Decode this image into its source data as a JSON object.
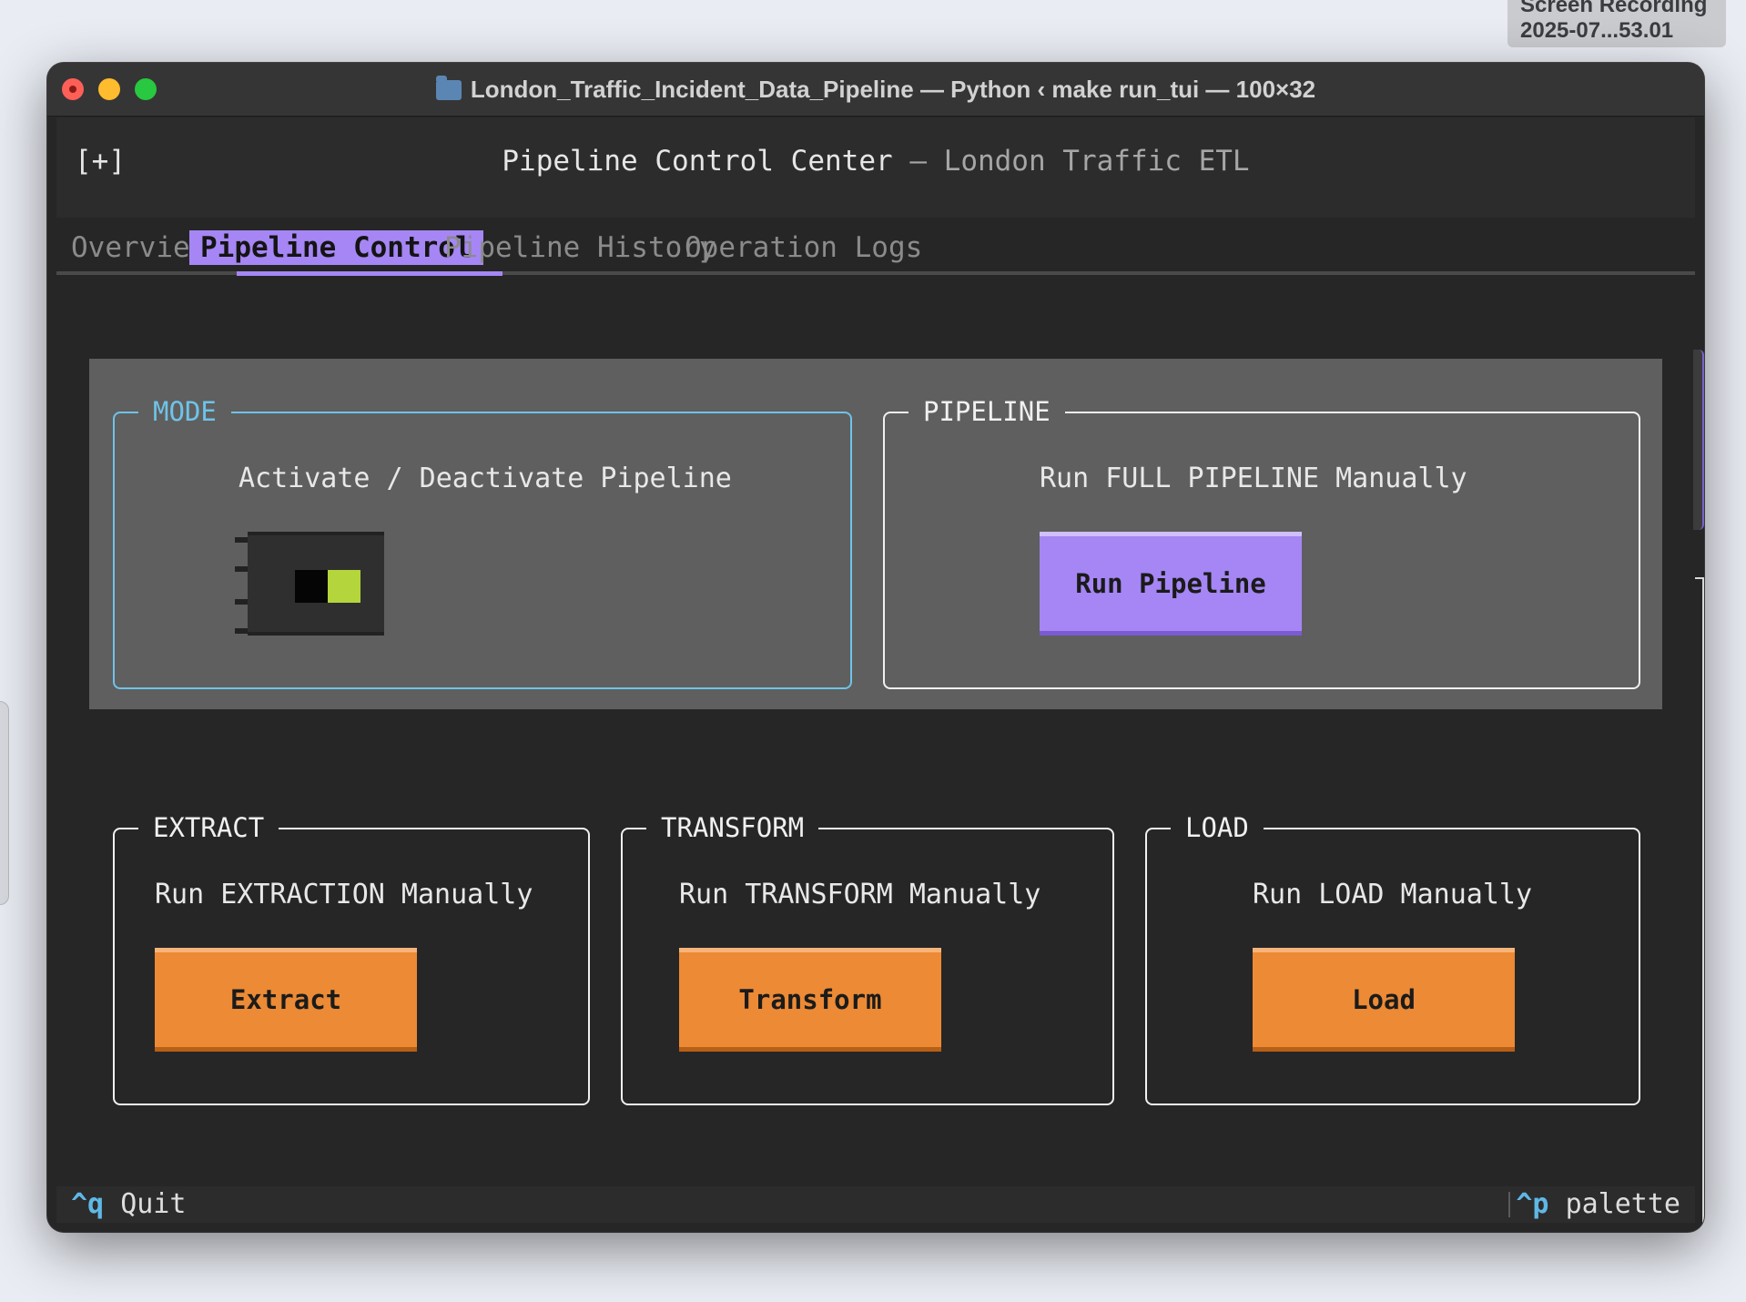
{
  "recording_badge": {
    "line1": "Screen Recording",
    "line2": "2025-07...53.01"
  },
  "window": {
    "title": "London_Traffic_Incident_Data_Pipeline — Python ‹ make run_tui — 100×32"
  },
  "header": {
    "toggle": "[+]",
    "title": "Pipeline Control Center",
    "separator": " — ",
    "subtitle": "London Traffic ETL"
  },
  "tabs": [
    {
      "label": "Overview",
      "active": false
    },
    {
      "label": "Pipeline Control",
      "active": true
    },
    {
      "label": "Pipeline History",
      "active": false
    },
    {
      "label": "Operation Logs",
      "active": false
    }
  ],
  "mode": {
    "title": "MODE",
    "caption": "Activate / Deactivate Pipeline",
    "switch_on": true
  },
  "pipeline": {
    "title": "PIPELINE",
    "caption": "Run FULL PIPELINE Manually",
    "button": "Run Pipeline"
  },
  "extract": {
    "title": "EXTRACT",
    "caption": "Run EXTRACTION Manually",
    "button": "Extract"
  },
  "transform": {
    "title": "TRANSFORM",
    "caption": "Run TRANSFORM Manually",
    "button": "Transform"
  },
  "load": {
    "title": "LOAD",
    "caption": "Run LOAD Manually",
    "button": "Load"
  },
  "footer": {
    "quit_key": "^q",
    "quit_label": "Quit",
    "palette_key": "^p",
    "palette_label": "palette"
  },
  "colors": {
    "accent_purple": "#a586f4",
    "accent_orange": "#ec8a35",
    "mode_border": "#6fc3e8",
    "switch_on": "#b5d53c",
    "key_blue": "#5fb8e6"
  }
}
